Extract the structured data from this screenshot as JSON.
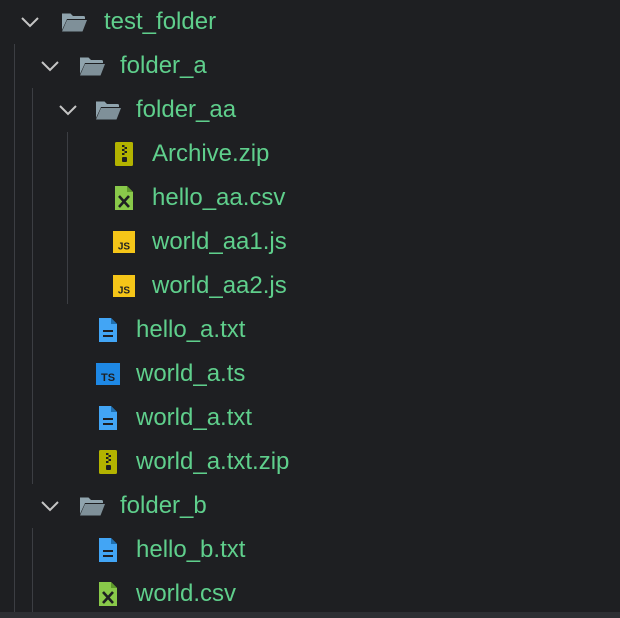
{
  "explorer": {
    "items": [
      {
        "label": "test_folder",
        "type": "folder",
        "expanded": true,
        "depth": 0,
        "icon": "folder-open-icon"
      },
      {
        "label": "folder_a",
        "type": "folder",
        "expanded": true,
        "depth": 1,
        "icon": "folder-open-icon"
      },
      {
        "label": "folder_aa",
        "type": "folder",
        "expanded": true,
        "depth": 2,
        "icon": "folder-open-icon"
      },
      {
        "label": "Archive.zip",
        "type": "zip",
        "depth": 3,
        "icon": "zip-file-icon"
      },
      {
        "label": "hello_aa.csv",
        "type": "csv",
        "depth": 3,
        "icon": "csv-file-icon"
      },
      {
        "label": "world_aa1.js",
        "type": "js",
        "depth": 3,
        "icon": "js-file-icon"
      },
      {
        "label": "world_aa2.js",
        "type": "js",
        "depth": 3,
        "icon": "js-file-icon"
      },
      {
        "label": "hello_a.txt",
        "type": "txt",
        "depth": 2,
        "icon": "text-file-icon"
      },
      {
        "label": "world_a.ts",
        "type": "ts",
        "depth": 2,
        "icon": "ts-file-icon"
      },
      {
        "label": "world_a.txt",
        "type": "txt",
        "depth": 2,
        "icon": "text-file-icon"
      },
      {
        "label": "world_a.txt.zip",
        "type": "zip",
        "depth": 2,
        "icon": "zip-file-icon"
      },
      {
        "label": "folder_b",
        "type": "folder",
        "expanded": true,
        "depth": 1,
        "icon": "folder-open-icon"
      },
      {
        "label": "hello_b.txt",
        "type": "txt",
        "depth": 2,
        "icon": "text-file-icon"
      },
      {
        "label": "world.csv",
        "type": "csv",
        "depth": 2,
        "icon": "csv-file-icon"
      }
    ]
  },
  "colors": {
    "background": "#1e1f22",
    "label": "#5fcf8c",
    "folder_icon": "#90a4ae",
    "chevron": "#c5c5c5",
    "zip_icon": "#b3b300",
    "csv_icon": "#89c94a",
    "js_icon": "#f5c518",
    "txt_icon": "#42a5f5",
    "ts_icon": "#1e88e5",
    "indent_guide": "#3c3e43"
  }
}
